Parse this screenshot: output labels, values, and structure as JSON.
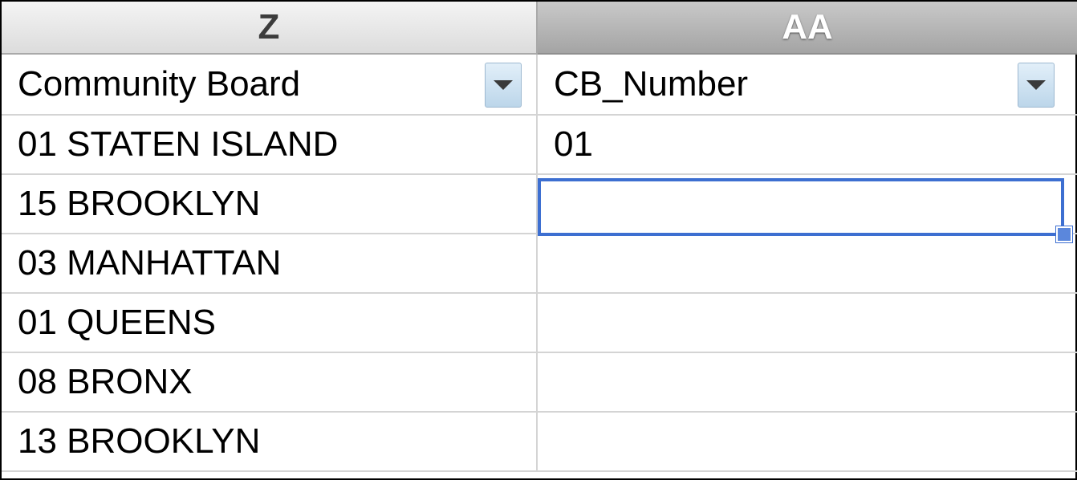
{
  "columns": {
    "z": "Z",
    "aa": "AA"
  },
  "headers": {
    "community_board": "Community Board",
    "cb_number": "CB_Number"
  },
  "rows": [
    {
      "community_board": "01 STATEN ISLAND",
      "cb_number": "01"
    },
    {
      "community_board": "15 BROOKLYN",
      "cb_number": ""
    },
    {
      "community_board": "03 MANHATTAN",
      "cb_number": ""
    },
    {
      "community_board": "01 QUEENS",
      "cb_number": ""
    },
    {
      "community_board": "08 BRONX",
      "cb_number": ""
    },
    {
      "community_board": "13 BROOKLYN",
      "cb_number": ""
    }
  ],
  "selected_cell": "AA3",
  "colors": {
    "selection": "#3d6fd1",
    "filter_button": "#c9dff0",
    "grid": "#d4d4d4"
  },
  "icons": {
    "filter": "dropdown-arrow-icon"
  }
}
